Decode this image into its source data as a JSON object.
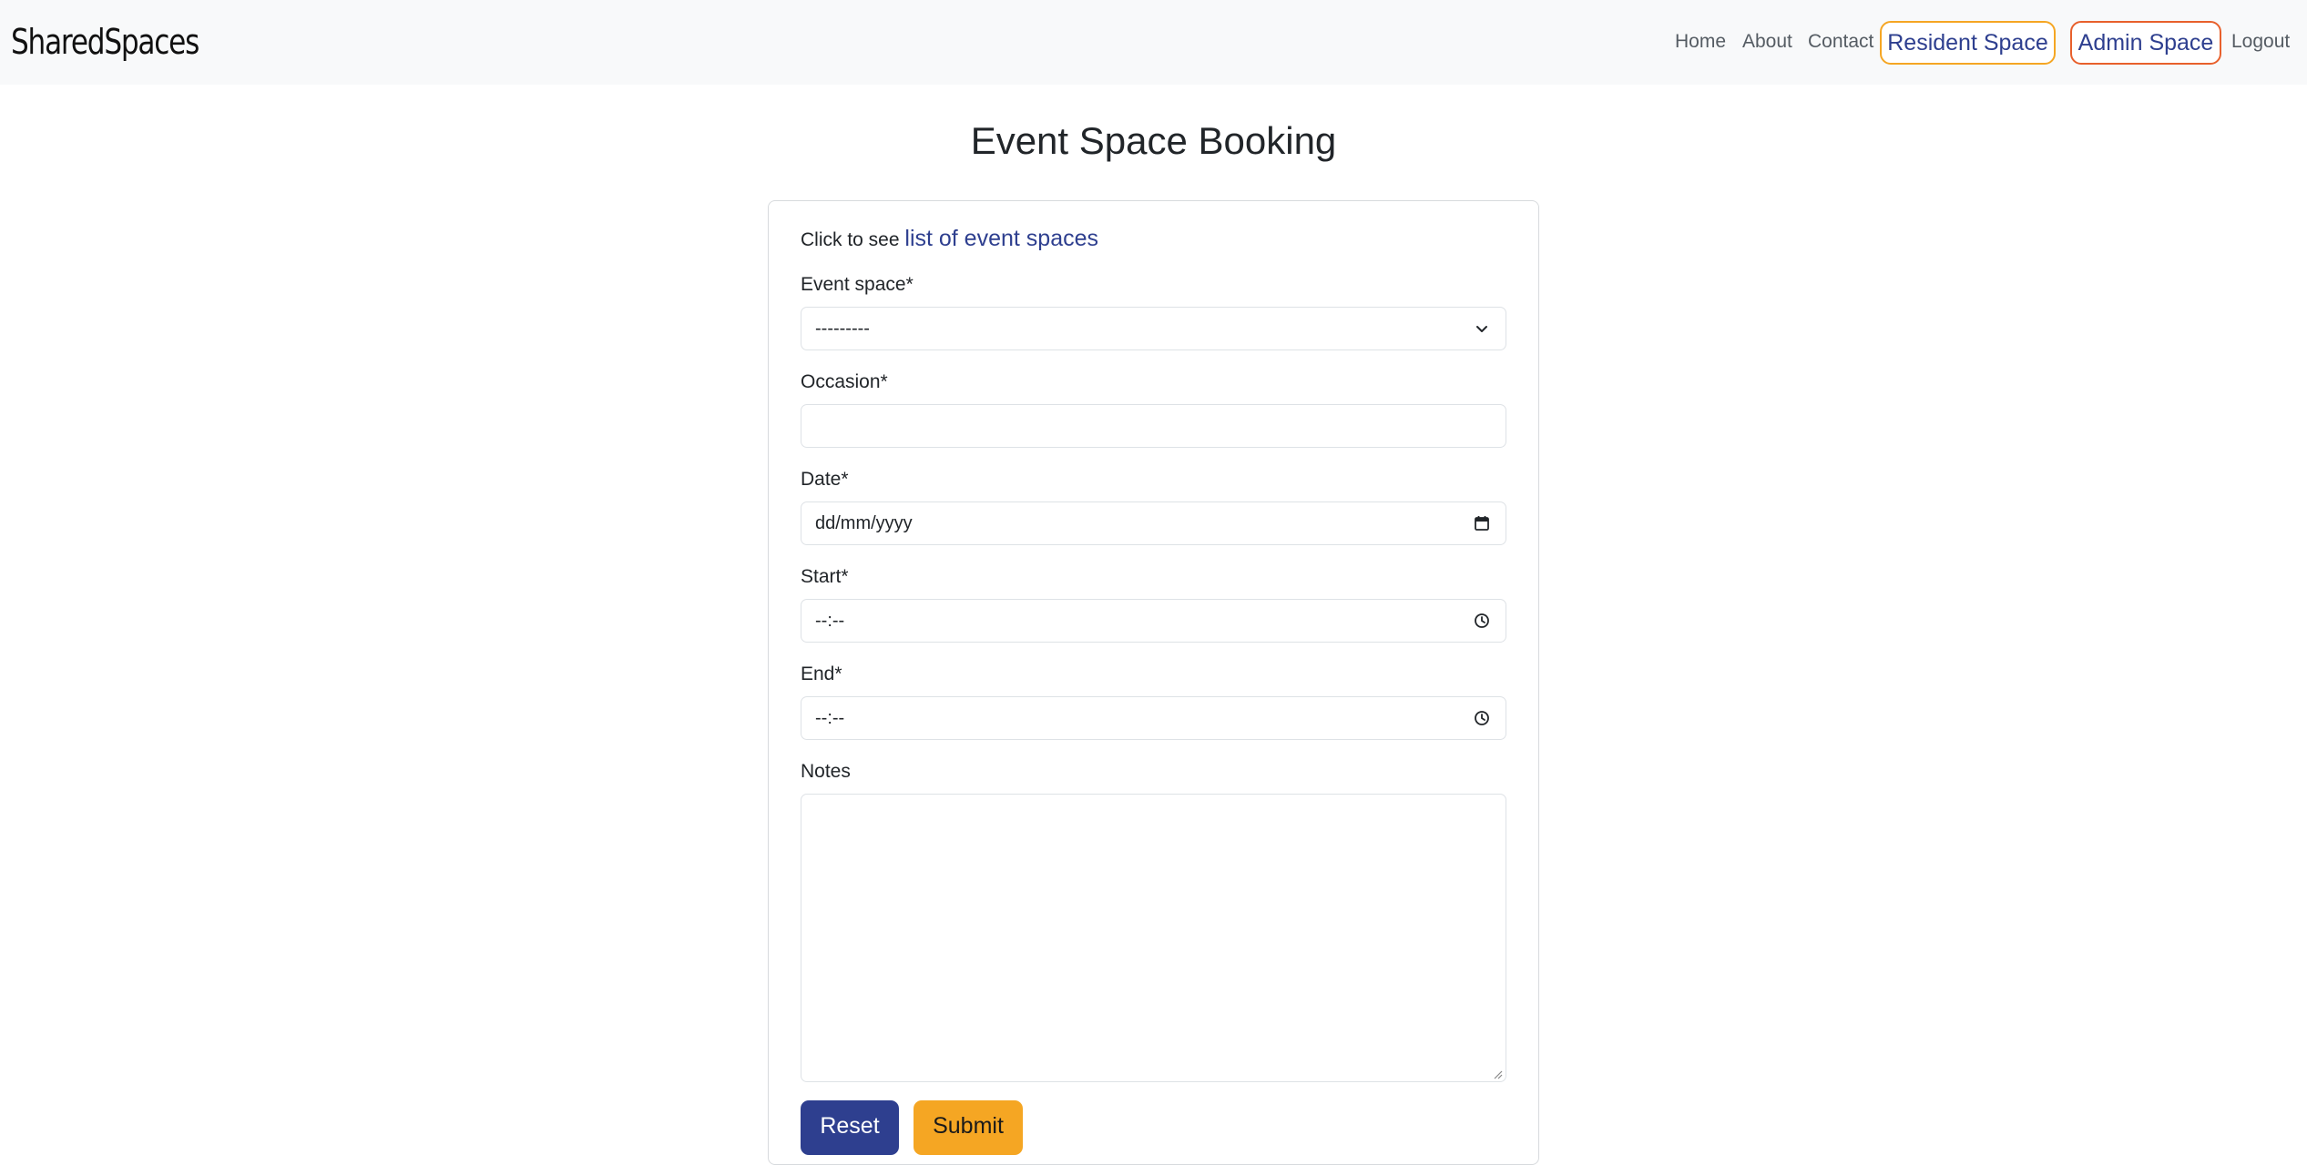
{
  "navbar": {
    "brand": "SharedSpaces",
    "links": {
      "home": "Home",
      "about": "About",
      "contact": "Contact",
      "logout": "Logout"
    },
    "resident_space": "Resident Space",
    "admin_space": "Admin Space"
  },
  "page": {
    "title": "Event Space Booking"
  },
  "form": {
    "intro_text": "Click to see",
    "intro_link": "list of event spaces",
    "event_space": {
      "label": "Event space*",
      "value": "---------"
    },
    "occasion": {
      "label": "Occasion*",
      "value": ""
    },
    "date": {
      "label": "Date*",
      "value": "dd/mm/yyyy"
    },
    "start": {
      "label": "Start*",
      "value": "--:--"
    },
    "end": {
      "label": "End*",
      "value": "--:--"
    },
    "notes": {
      "label": "Notes",
      "value": ""
    },
    "reset_label": "Reset",
    "submit_label": "Submit"
  },
  "colors": {
    "primary": "#2e3f8f",
    "accent": "#f5a623",
    "admin_border": "#e8602c",
    "navbar_bg": "#f8f9fa"
  },
  "icons": {
    "select": "chevron-down-icon",
    "date": "calendar-icon",
    "time": "clock-icon",
    "textarea": "resize-grip-icon"
  }
}
